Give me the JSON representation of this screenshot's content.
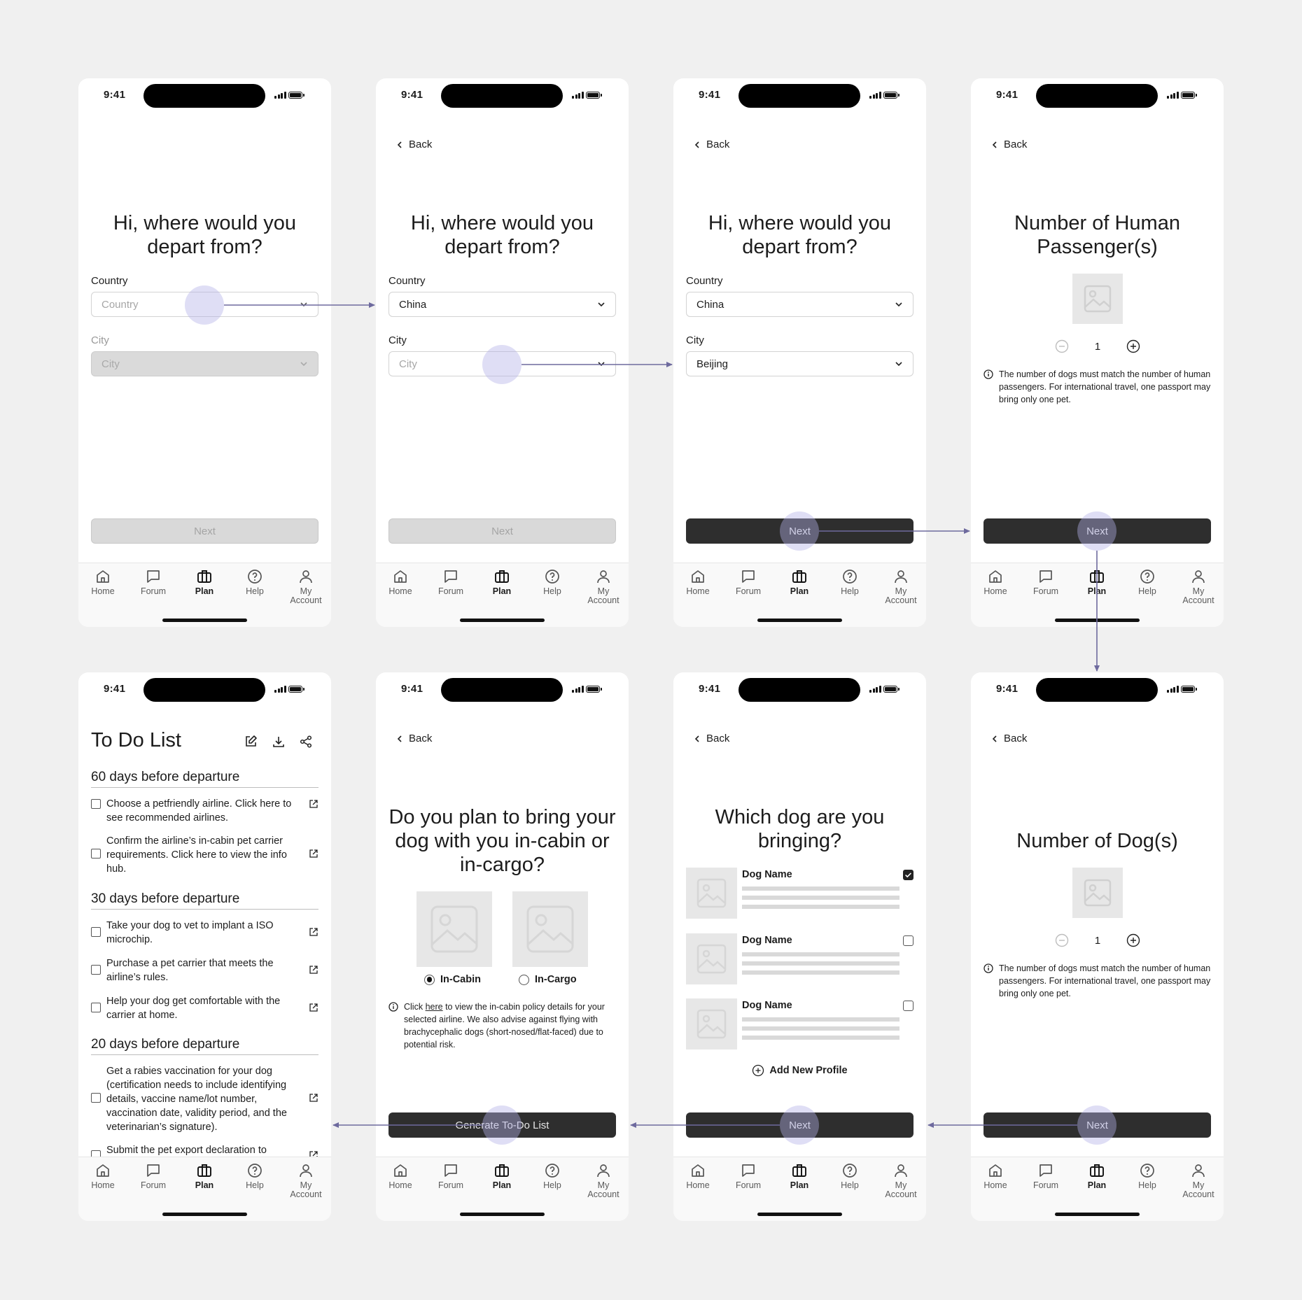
{
  "status": {
    "time": "9:41"
  },
  "tabs": [
    "Home",
    "Forum",
    "Plan",
    "Help",
    "My",
    "Account"
  ],
  "back_label": "Back",
  "screen1": {
    "title": "Hi, where would you depart from?",
    "country_label": "Country",
    "country_placeholder": "Country",
    "city_label": "City",
    "city_placeholder": "City",
    "next_label": "Next"
  },
  "screen2": {
    "title": "Hi, where would you depart from?",
    "country_label": "Country",
    "country_value": "China",
    "city_label": "City",
    "city_placeholder": "City",
    "next_label": "Next"
  },
  "screen3": {
    "title": "Hi, where would you depart from?",
    "country_label": "Country",
    "country_value": "China",
    "city_label": "City",
    "city_value": "Beijing",
    "next_label": "Next"
  },
  "screen4": {
    "title": "Number of Human Passenger(s)",
    "count": "1",
    "info": "The number of dogs must match the number of human passengers. For international travel, one passport may bring only one pet.",
    "next_label": "Next"
  },
  "screen5": {
    "title": "To Do List",
    "sections": [
      {
        "heading": "60 days before departure",
        "items": [
          "Choose a petfriendly airline. Click here to see recommended airlines.",
          "Confirm the airline’s in-cabin pet carrier requirements. Click here to view the info hub."
        ]
      },
      {
        "heading": "30 days before departure",
        "items": [
          "Take your dog to vet to implant a ISO microchip.",
          "Purchase a pet carrier that meets the airline’s rules.",
          "Help your dog get comfortable with the carrier at home."
        ]
      },
      {
        "heading": "20 days before departure",
        "items": [
          "Get a rabies vaccination for your dog (certification needs to include identifying details, vaccine name/lot number, vaccination date, validity period, and the veterinarian’s signature).",
          "Submit the pet export declaration to"
        ]
      }
    ]
  },
  "screen6": {
    "title": "Do you plan to bring your dog with you in-cabin or in-cargo?",
    "option_cabin": "In-Cabin",
    "option_cargo": "In-Cargo",
    "info_pre": "Click ",
    "info_link": "here",
    "info_post": " to view the in-cabin policy details for your selected airline. We also advise against flying with brachycephalic dogs (short-nosed/flat-faced) due to potential risk.",
    "button_label": "Generate To-Do List"
  },
  "screen7": {
    "title": "Which dog are you bringing?",
    "dogs": [
      {
        "name": "Dog Name",
        "checked": true
      },
      {
        "name": "Dog Name",
        "checked": false
      },
      {
        "name": "Dog Name",
        "checked": false
      }
    ],
    "add_label": "Add New Profile",
    "next_label": "Next"
  },
  "screen8": {
    "title": "Number of Dog(s)",
    "count": "1",
    "info": "The number of dogs must match the number of human passengers. For international travel, one passport may bring only one pet.",
    "next_label": "Next"
  },
  "colors": {
    "accent_arrow": "#6e6a9e",
    "tap_highlight": "#b2b0e8",
    "button_dark": "#2e2e2e"
  }
}
